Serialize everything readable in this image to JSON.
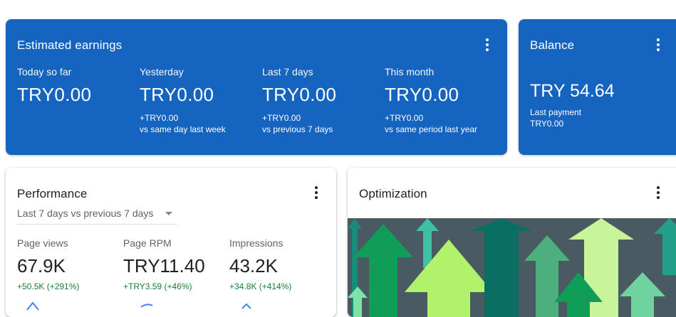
{
  "earnings": {
    "title": "Estimated earnings",
    "metrics": [
      {
        "label": "Today so far",
        "value": "TRY0.00",
        "delta": "",
        "compare": ""
      },
      {
        "label": "Yesterday",
        "value": "TRY0.00",
        "delta": "+TRY0.00",
        "compare": "vs same day last week"
      },
      {
        "label": "Last 7 days",
        "value": "TRY0.00",
        "delta": "+TRY0.00",
        "compare": "vs previous 7 days"
      },
      {
        "label": "This month",
        "value": "TRY0.00",
        "delta": "+TRY0.00",
        "compare": "vs same period last year"
      }
    ]
  },
  "balance": {
    "title": "Balance",
    "value": "TRY 54.64",
    "last_payment_label": "Last payment",
    "last_payment_value": "TRY0.00"
  },
  "performance": {
    "title": "Performance",
    "range_selected": "Last 7 days vs previous 7 days",
    "metrics": [
      {
        "label": "Page views",
        "value": "67.9K",
        "change": "+50.5K (+291%)"
      },
      {
        "label": "Page RPM",
        "value": "TRY11.40",
        "change": "+TRY3.59 (+46%)"
      },
      {
        "label": "Impressions",
        "value": "43.2K",
        "change": "+34.8K (+414%)"
      }
    ]
  },
  "optimization": {
    "title": "Optimization"
  },
  "icons": {
    "menu": "more-vert-icon",
    "dropdown": "arrow-drop-down-icon"
  },
  "colors": {
    "card_blue": "#1565c0",
    "positive_green": "#188038",
    "illustration_bg": "#4a5a63"
  }
}
